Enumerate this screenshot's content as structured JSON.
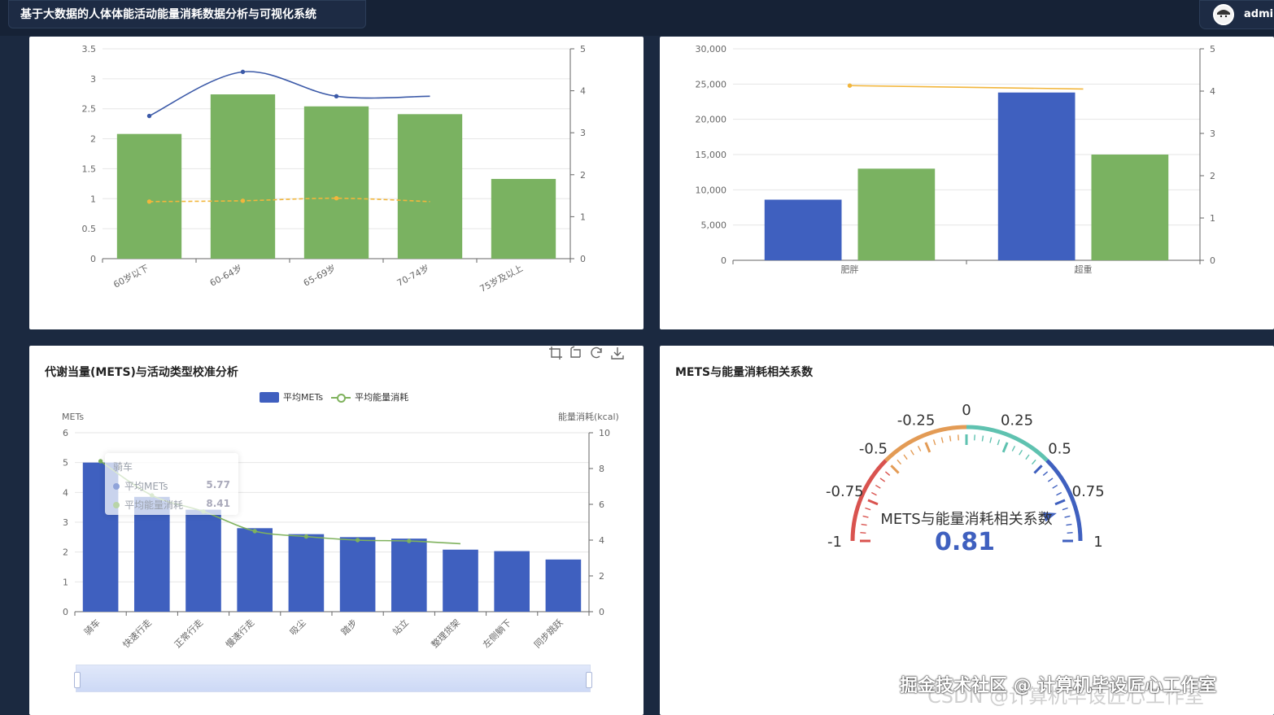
{
  "app": {
    "title": "基于大数据的人体体能活动能量消耗数据分析与可视化系统",
    "user": "admin"
  },
  "colors": {
    "green": "#7ab261",
    "blue": "#3f60bf",
    "line_blue": "#3c5aa8",
    "line_orange": "#f2b63c",
    "gauge_red": "#d9534f",
    "gauge_orange": "#e39b55",
    "gauge_teal": "#5fc2b0",
    "gauge_blue": "#3f60bf"
  },
  "panel_tl": {
    "chart_data": {
      "type": "bar",
      "categories": [
        "60岁以下",
        "60-64岁",
        "65-69岁",
        "70-74岁",
        "75岁及以上"
      ],
      "series": [
        {
          "type": "bar",
          "values": [
            2.08,
            2.74,
            2.54,
            2.41,
            1.33
          ]
        },
        {
          "type": "line",
          "axis": "right",
          "values": [
            3.4,
            4.45,
            3.87,
            3.87
          ]
        },
        {
          "type": "line",
          "axis": "right",
          "values": [
            1.36,
            1.38,
            1.44,
            1.36
          ]
        }
      ],
      "yticks_left": [
        "0",
        "0.5",
        "1",
        "1.5",
        "2",
        "2.5",
        "3",
        "3.5"
      ],
      "yticks_right": [
        "0",
        "1",
        "2",
        "3",
        "4",
        "5"
      ],
      "ylim": [
        0,
        3.5
      ],
      "ylim_right": [
        0,
        5
      ]
    }
  },
  "panel_tr": {
    "chart_data": {
      "type": "bar",
      "categories": [
        "肥胖",
        "超重"
      ],
      "series": [
        {
          "type": "bar",
          "values": [
            8600,
            23800
          ]
        },
        {
          "type": "bar",
          "values": [
            13000,
            15000
          ]
        },
        {
          "type": "line",
          "axis": "right",
          "values": [
            4.13,
            4.05
          ]
        }
      ],
      "yticks_left": [
        "0",
        "5,000",
        "10,000",
        "15,000",
        "20,000",
        "25,000",
        "30,000"
      ],
      "yticks_right": [
        "0",
        "1",
        "2",
        "3",
        "4",
        "5"
      ],
      "ylim": [
        0,
        30000
      ],
      "ylim_right": [
        0,
        5
      ]
    }
  },
  "panel_bl": {
    "title": "代谢当量(METS)与活动类型校准分析",
    "legend": {
      "bar": "平均METs",
      "line": "平均能量消耗"
    },
    "toolbar": [
      "zoom-icon",
      "zoom-reset-icon",
      "restore-icon",
      "download-icon"
    ],
    "chart_data": {
      "type": "bar",
      "categories": [
        "骑车",
        "快速行走",
        "正常行走",
        "慢速行走",
        "吸尘",
        "踏步",
        "站立",
        "整理货架",
        "左侧躺下",
        "同步跳跃"
      ],
      "series": [
        {
          "name": "平均METs",
          "type": "bar",
          "values": [
            5.0,
            3.85,
            3.42,
            2.8,
            2.6,
            2.5,
            2.45,
            2.08,
            2.03,
            1.75
          ]
        },
        {
          "name": "平均能量消耗",
          "type": "line",
          "axis": "right",
          "values": [
            8.41,
            6.5,
            5.6,
            4.5,
            4.2,
            4.0,
            3.95,
            3.8
          ]
        }
      ],
      "ylabel": "METs",
      "ylabel_right": "能量消耗(kcal)",
      "yticks_left": [
        "0",
        "1",
        "2",
        "3",
        "4",
        "5",
        "6"
      ],
      "yticks_right": [
        "0",
        "2",
        "4",
        "6",
        "8",
        "10"
      ],
      "ylim": [
        0,
        6
      ],
      "ylim_right": [
        0,
        10
      ]
    },
    "tooltip": {
      "title": "骑车",
      "rows": [
        {
          "label": "平均METs",
          "value": "5.77"
        },
        {
          "label": "平均能量消耗",
          "value": "8.41"
        }
      ]
    }
  },
  "panel_br": {
    "title": "METS与能量消耗相关系数",
    "gauge": {
      "value": 0.81,
      "value_label": "0.81",
      "name": "METS与能量消耗相关系数",
      "min": -1,
      "max": 1,
      "tick_labels": [
        "-1",
        "-0.75",
        "-0.5",
        "-0.25",
        "0",
        "0.25",
        "0.5",
        "0.75",
        "1"
      ]
    }
  },
  "watermark": {
    "text": "掘金技术社区 @ 计算机毕设匠心工作室",
    "text2": "CSDN @计算机毕设匠心工作室"
  }
}
